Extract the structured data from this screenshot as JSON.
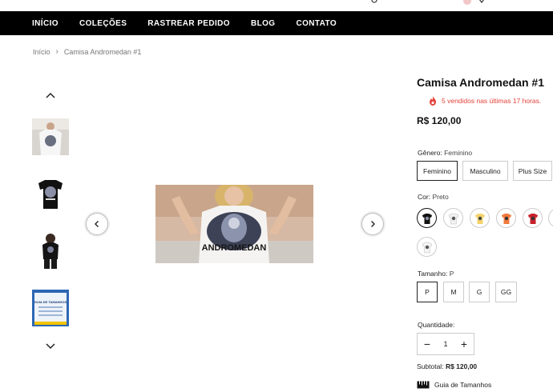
{
  "nav": {
    "items": [
      {
        "label": "INÍCIO"
      },
      {
        "label": "COLEÇÕES"
      },
      {
        "label": "RASTREAR PEDIDO"
      },
      {
        "label": "BLOG"
      },
      {
        "label": "CONTATO"
      }
    ]
  },
  "breadcrumb": {
    "home": "Início",
    "current": "Camisa Andromedan #1"
  },
  "gallery": {
    "main_text": "ANDROMEDAN",
    "size_guide_thumb_lines": [
      "GUIA DE TAMANHOS"
    ]
  },
  "product": {
    "title": "Camisa Andromedan #1",
    "sold_notice": "5 vendidos nas últimas 17 horas.",
    "price": "R$ 120,00",
    "gender": {
      "label": "Gênero:",
      "value": "Feminino",
      "options": [
        "Feminino",
        "Masculino",
        "Plus Size"
      ]
    },
    "color": {
      "label": "Cor:",
      "value": "Preto",
      "swatches": [
        "#111111",
        "#f2f2f2",
        "#f3d36b",
        "#f07a3c",
        "#c8212b",
        "#ffffff",
        "#f5f5f5"
      ]
    },
    "size": {
      "label": "Tamanho:",
      "value": "P",
      "options": [
        "P",
        "M",
        "G",
        "GG"
      ]
    },
    "quantity": {
      "label": "Quantidade:",
      "value": "1",
      "minus": "−",
      "plus": "+"
    },
    "subtotal": {
      "label": "Subtotal:",
      "value": "R$ 120,00"
    },
    "size_guide": "Guia de Tamanhos"
  },
  "colors": {
    "nav_bg": "#000000",
    "accent_red": "#e4423a"
  }
}
